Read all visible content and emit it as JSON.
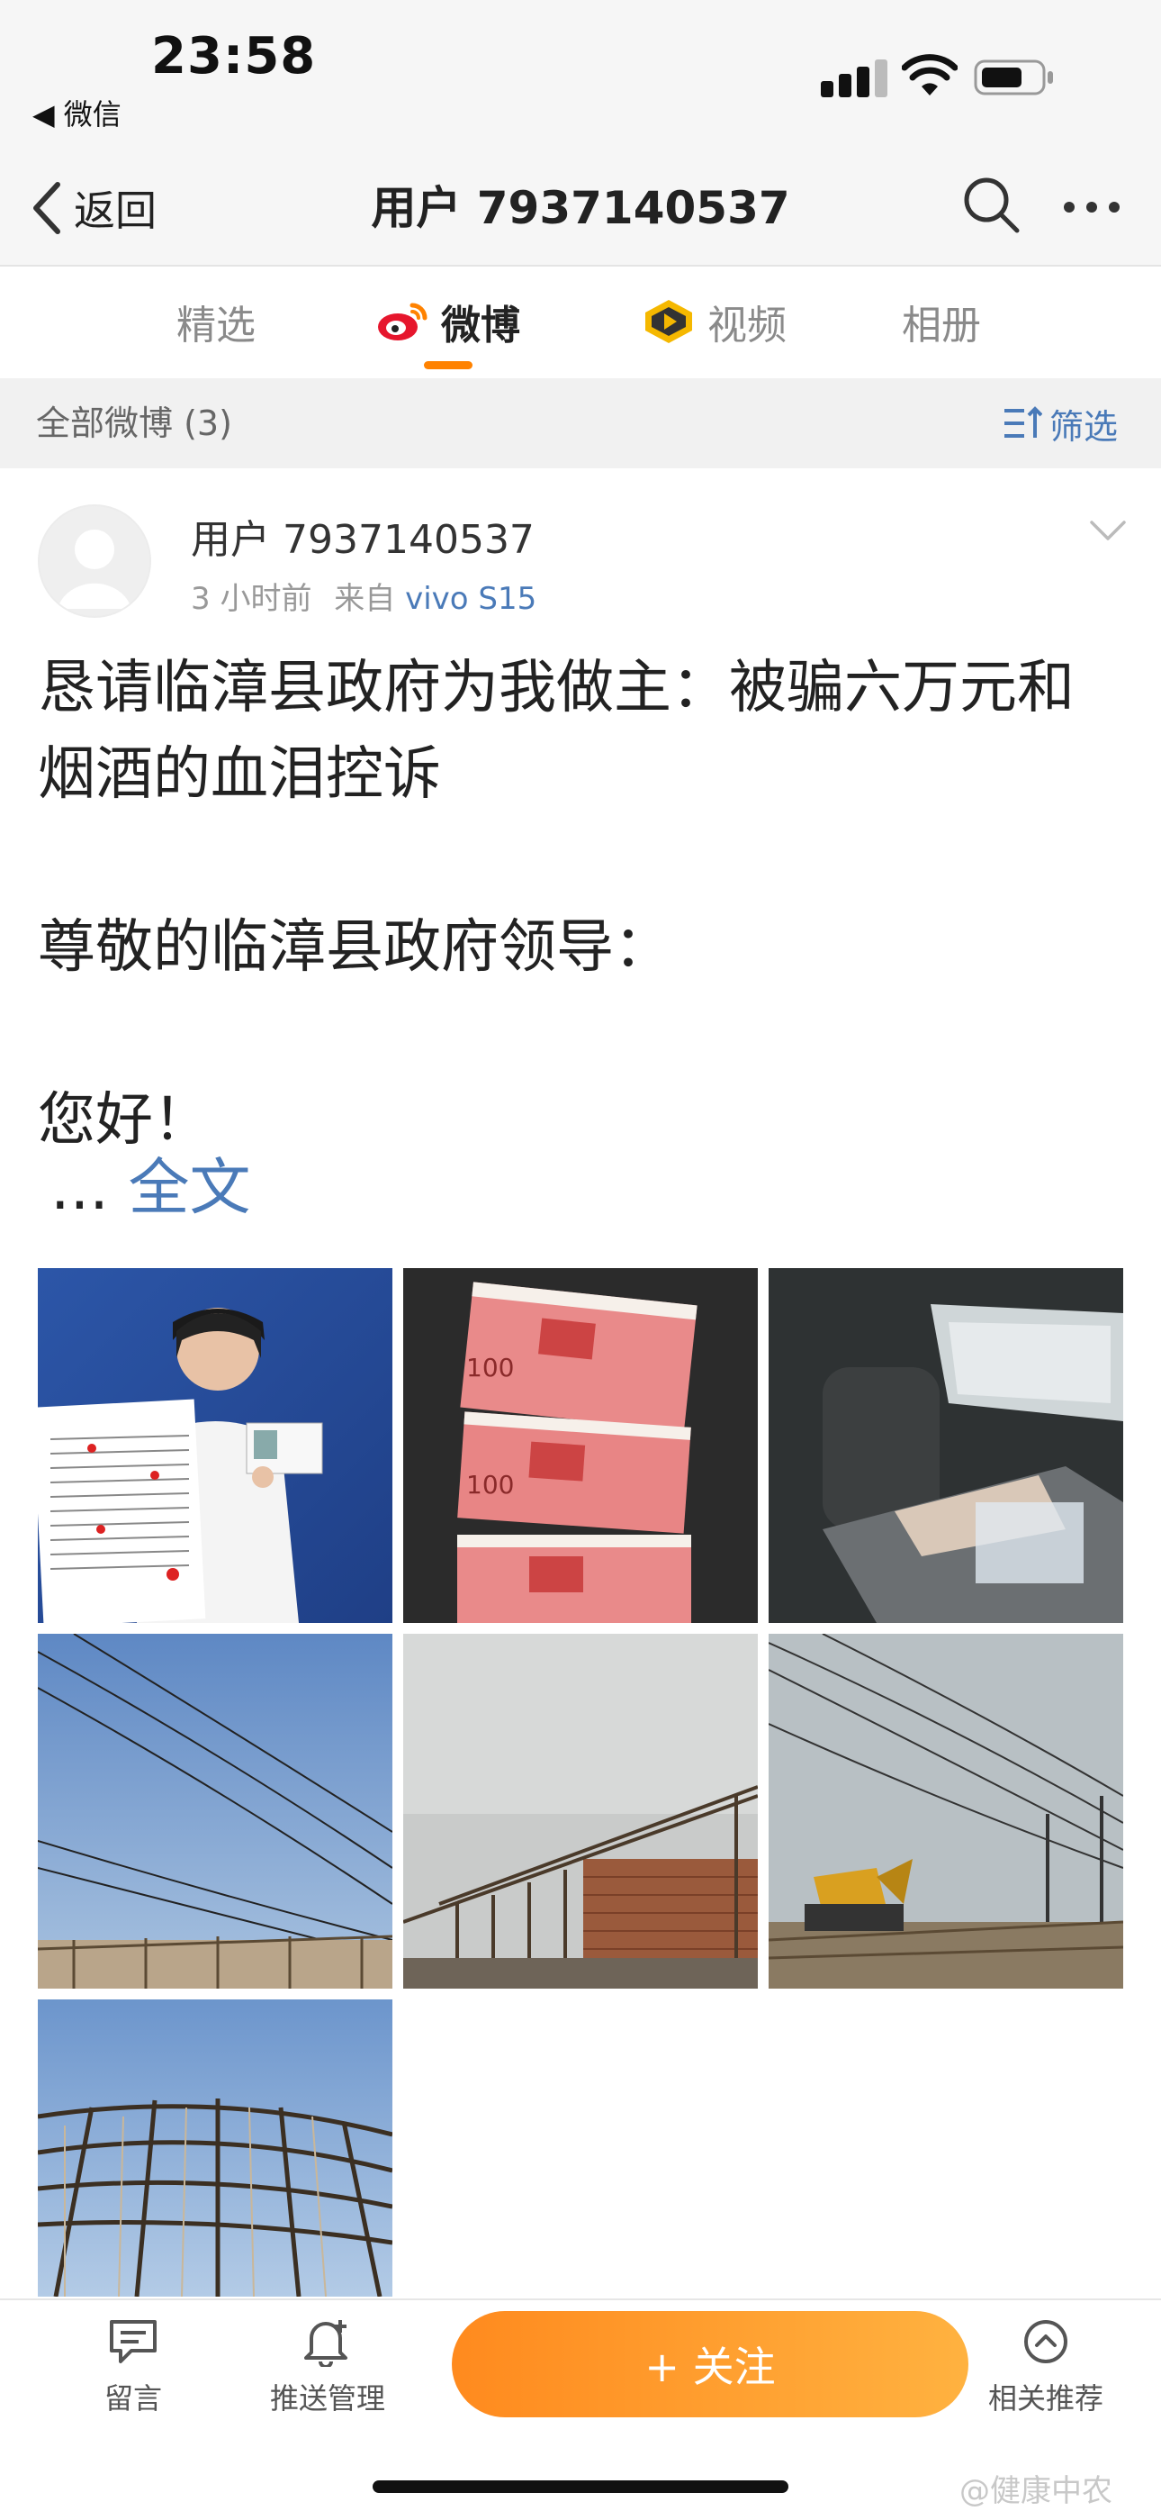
{
  "status_bar": {
    "time": "23:58",
    "back_app": "◀ 微信"
  },
  "nav": {
    "back_label": "返回",
    "title": "用户 7937140537"
  },
  "tabs": [
    {
      "label": "精选",
      "active": false
    },
    {
      "label": "微博",
      "active": true,
      "icon": "weibo-icon"
    },
    {
      "label": "视频",
      "active": false,
      "icon": "video-icon"
    },
    {
      "label": "相册",
      "active": false
    }
  ],
  "filter_bar": {
    "label": "全部微博 (3)",
    "button": "筛选"
  },
  "post": {
    "username": "用户 7937140537",
    "time": "3 小时前",
    "source_prefix": "来自",
    "device": "vivo S15",
    "paragraphs": [
      "恳请临漳县政府为我做主：被骗六万元和烟酒的血泪控诉",
      "尊敬的临漳县政府领导：",
      "您好！"
    ],
    "ellipsis": "...",
    "fulltext_link": "全文",
    "images": [
      {
        "name": "photo-woman-holding-letter"
      },
      {
        "name": "photo-cash-bundles"
      },
      {
        "name": "photo-car-interior"
      },
      {
        "name": "photo-power-lines-sky"
      },
      {
        "name": "photo-demolished-greenhouse"
      },
      {
        "name": "photo-excavator-site"
      },
      {
        "name": "photo-greenhouse-frame"
      }
    ]
  },
  "bottom_bar": {
    "comment": "留言",
    "push": "推送管理",
    "follow": "+ 关注",
    "related": "相关推荐"
  },
  "watermark": "@健康中农",
  "colors": {
    "accent": "#ff8200",
    "link": "#4a7ab8"
  }
}
